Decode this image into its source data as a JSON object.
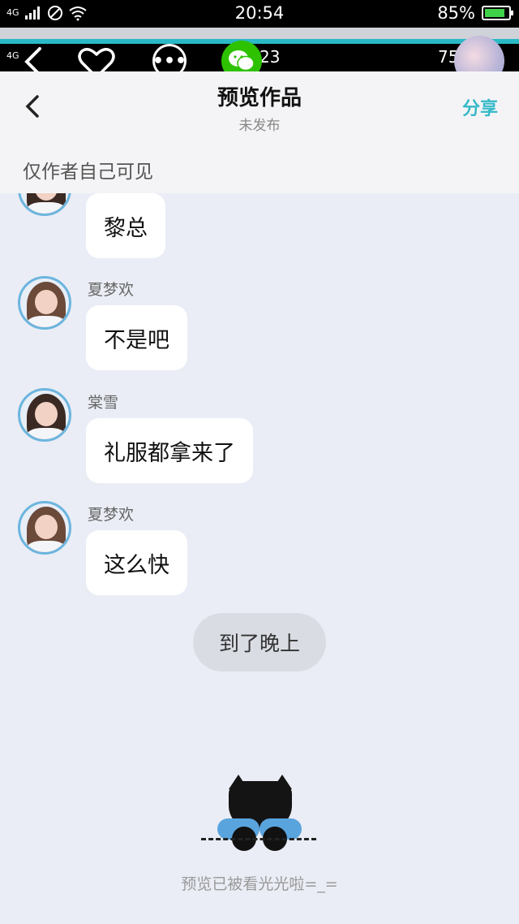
{
  "status": {
    "signal": "4G",
    "time": "20:54",
    "battery": "85%"
  },
  "inner_status": {
    "time": "23",
    "battery": "75"
  },
  "header": {
    "title": "预览作品",
    "subtitle": "未发布",
    "share": "分享"
  },
  "notice": "仅作者自己可见",
  "messages": [
    {
      "name": "",
      "text": "黎总"
    },
    {
      "name": "夏梦欢",
      "text": "不是吧"
    },
    {
      "name": "棠雪",
      "text": "礼服都拿来了"
    },
    {
      "name": "夏梦欢",
      "text": "这么快"
    }
  ],
  "narration": "到了晚上",
  "footer": "预览已被看光光啦=_="
}
